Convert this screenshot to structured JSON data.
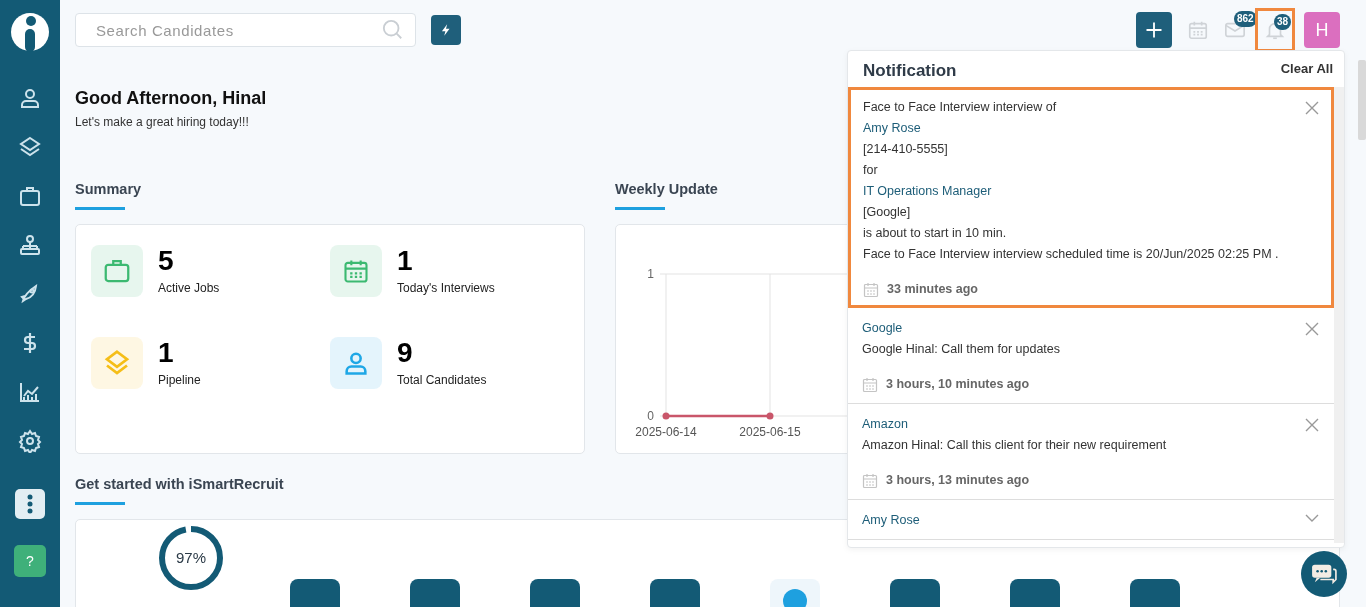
{
  "search": {
    "placeholder": "Search Candidates"
  },
  "topbar": {
    "mail_badge": "862",
    "bell_badge": "38",
    "bell_highlighted": true,
    "avatar": "H"
  },
  "greeting": {
    "title": "Good Afternoon,  Hinal",
    "subtitle": "Let's make a great hiring today!!!"
  },
  "summary": {
    "title": "Summary",
    "stats": [
      {
        "kind": "briefcase",
        "color": "#3cb971",
        "value": "5",
        "label": "Active Jobs"
      },
      {
        "kind": "calendar",
        "color": "#3cb971",
        "value": "1",
        "label": "Today's Interviews"
      },
      {
        "kind": "layers",
        "color": "#f5be18",
        "value": "1",
        "label": "Pipeline"
      },
      {
        "kind": "person",
        "color": "#1ea7e6",
        "value": "9",
        "label": "Total Candidates"
      }
    ]
  },
  "weekly": {
    "title": "Weekly Update",
    "chart_data": {
      "type": "line",
      "categories": [
        "2025-06-14",
        "2025-06-15"
      ],
      "yticks": [
        0,
        1
      ],
      "ylim": [
        0,
        1
      ],
      "series": [
        {
          "color": "#c9566a",
          "marker": true,
          "values": [
            0,
            0
          ]
        }
      ]
    }
  },
  "get_started": {
    "title": "Get started with iSmartRecruit",
    "progress": {
      "level": 0.97,
      "reading": "97%"
    },
    "tiles": [
      {
        "kind": "dark"
      },
      {
        "kind": "dark"
      },
      {
        "kind": "dark"
      },
      {
        "kind": "dark"
      },
      {
        "kind": "light"
      },
      {
        "kind": "dark"
      },
      {
        "kind": "dark"
      },
      {
        "kind": "dark"
      }
    ]
  },
  "help": "?",
  "notifications": {
    "title": "Notification",
    "clear": "Clear All",
    "items": [
      {
        "highlighted": true,
        "expanded": true,
        "lines": [
          {
            "kind": "text",
            "text": "Face to Face Interview interview of"
          },
          {
            "kind": "link",
            "text": "Amy Rose"
          },
          {
            "kind": "text",
            "text": "[214-410-5555]"
          },
          {
            "kind": "text",
            "text": "for"
          },
          {
            "kind": "link",
            "text": "IT Operations Manager"
          },
          {
            "kind": "text",
            "text": "[Google]"
          },
          {
            "kind": "text",
            "text": "is about to start in 10 min."
          },
          {
            "kind": "text",
            "text": "Face to Face Interview interview scheduled time is 20/Jun/2025 02:25 PM ."
          }
        ],
        "time": "33 minutes ago"
      },
      {
        "highlighted": false,
        "expanded": true,
        "lines": [
          {
            "kind": "link",
            "text": "Google"
          },
          {
            "kind": "text",
            "text": "Google Hinal: Call them for updates"
          }
        ],
        "time": "3 hours, 10 minutes ago"
      },
      {
        "highlighted": false,
        "expanded": true,
        "lines": [
          {
            "kind": "link",
            "text": "Amazon"
          },
          {
            "kind": "text",
            "text": "Amazon Hinal: Call this client for their new requirement"
          }
        ],
        "time": "3 hours, 13 minutes ago"
      },
      {
        "highlighted": false,
        "expanded": false,
        "lines": [
          {
            "kind": "link",
            "text": "Amy Rose"
          }
        ]
      }
    ]
  }
}
